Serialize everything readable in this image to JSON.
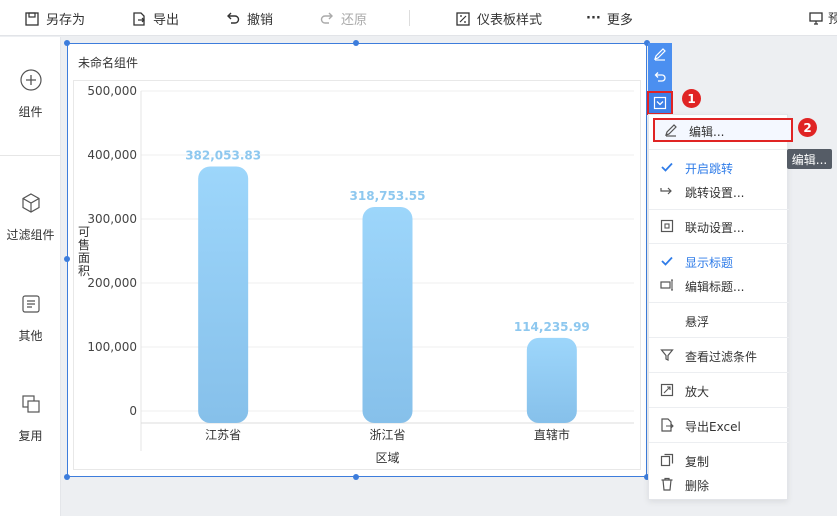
{
  "toolbar": {
    "save_as": "另存为",
    "export": "导出",
    "undo": "撤销",
    "redo": "还原",
    "dashboard_style": "仪表板样式",
    "more": "更多",
    "preview_partial": "预"
  },
  "sidebar": {
    "items": [
      {
        "label": "组件",
        "icon": "plus-circle-icon"
      },
      {
        "label": "过滤组件",
        "icon": "cube-icon"
      },
      {
        "label": "其他",
        "icon": "document-icon"
      },
      {
        "label": "复用",
        "icon": "copy-icon"
      }
    ]
  },
  "widget": {
    "title": "未命名组件"
  },
  "chart_data": {
    "type": "bar",
    "categories": [
      "江苏省",
      "浙江省",
      "直辖市"
    ],
    "values": [
      382053.83,
      318753.55,
      114235.99
    ],
    "value_labels": [
      "382,053.83",
      "318,753.55",
      "114,235.99"
    ],
    "xlabel": "区域",
    "ylabel": "可售面积",
    "ylim": [
      0,
      500000
    ],
    "yticks": [
      "500,000",
      "400,000",
      "300,000",
      "200,000",
      "100,000",
      "0"
    ],
    "grid": true,
    "colors": {
      "bar_top": "#9dd6fb",
      "bar_bottom": "#86c0ea",
      "label": "#8ec8ef"
    }
  },
  "badges": {
    "first": "1",
    "second": "2"
  },
  "menu": {
    "edit": "编辑...",
    "enable_jump": "开启跳转",
    "jump_settings": "跳转设置...",
    "linkage_settings": "联动设置...",
    "show_title": "显示标题",
    "edit_title": "编辑标题...",
    "float": "悬浮",
    "view_filter": "查看过滤条件",
    "zoom": "放大",
    "export_excel": "导出Excel",
    "copy": "复制",
    "delete": "删除"
  },
  "tooltip": "编辑...",
  "colors": {
    "accent": "#3d7ddc",
    "highlight": "#e02424",
    "checked": "#2f7ce8"
  }
}
